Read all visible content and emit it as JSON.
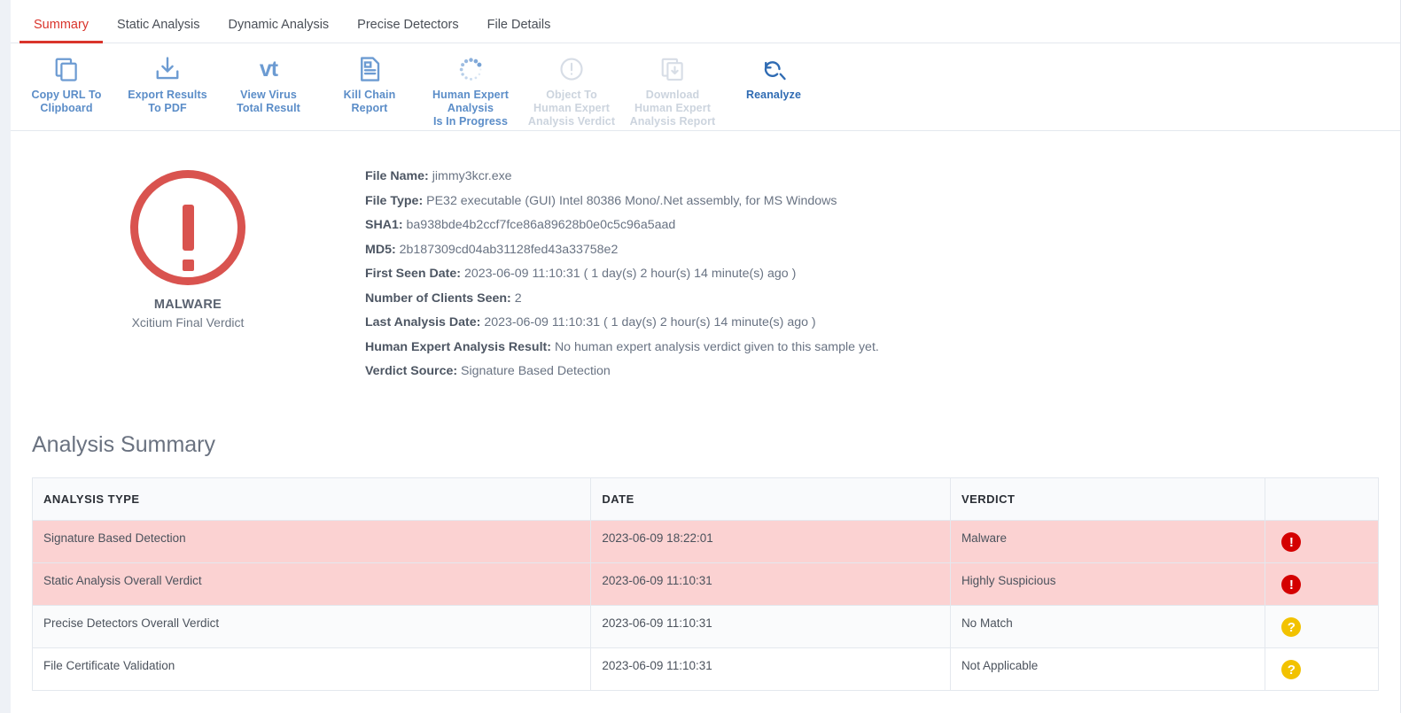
{
  "tabs": [
    {
      "label": "Summary",
      "active": true
    },
    {
      "label": "Static Analysis",
      "active": false
    },
    {
      "label": "Dynamic Analysis",
      "active": false
    },
    {
      "label": "Precise Detectors",
      "active": false
    },
    {
      "label": "File Details",
      "active": false
    }
  ],
  "toolbar": [
    {
      "icon": "copy-icon",
      "line1": "Copy URL To",
      "line2": "Clipboard",
      "line3": "",
      "state": "enabled"
    },
    {
      "icon": "download-pdf-icon",
      "line1": "Export Results",
      "line2": "To PDF",
      "line3": "",
      "state": "enabled"
    },
    {
      "icon": "virustotal-icon",
      "line1": "View Virus",
      "line2": "Total Result",
      "line3": "",
      "state": "enabled"
    },
    {
      "icon": "document-icon",
      "line1": "Kill Chain",
      "line2": "Report",
      "line3": "",
      "state": "enabled"
    },
    {
      "icon": "spinner-icon",
      "line1": "Human Expert",
      "line2": "Analysis",
      "line3": "Is In Progress",
      "state": "enabled"
    },
    {
      "icon": "alert-circle-icon",
      "line1": "Object To",
      "line2": "Human Expert",
      "line3": "Analysis Verdict",
      "state": "disabled"
    },
    {
      "icon": "download-report-icon",
      "line1": "Download",
      "line2": "Human Expert",
      "line3": "Analysis Report",
      "state": "disabled"
    },
    {
      "icon": "reanalyze-icon",
      "line1": "Reanalyze",
      "line2": "",
      "line3": "",
      "state": "dark"
    }
  ],
  "verdict": {
    "icon": "malware-alert-icon",
    "title": "MALWARE",
    "subtitle": "Xcitium Final Verdict",
    "color": "#d9534f"
  },
  "file_info": [
    {
      "label": "File Name:",
      "value": "jimmy3kcr.exe"
    },
    {
      "label": "File Type:",
      "value": "PE32 executable (GUI) Intel 80386 Mono/.Net assembly, for MS Windows"
    },
    {
      "label": "SHA1:",
      "value": "ba938bde4b2ccf7fce86a89628b0e0c5c96a5aad"
    },
    {
      "label": "MD5:",
      "value": "2b187309cd04ab31128fed43a33758e2"
    },
    {
      "label": "First Seen Date:",
      "value": "2023-06-09 11:10:31 ( 1 day(s) 2 hour(s) 14 minute(s) ago )"
    },
    {
      "label": "Number of Clients Seen:",
      "value": "2"
    },
    {
      "label": "Last Analysis Date:",
      "value": "2023-06-09 11:10:31 ( 1 day(s) 2 hour(s) 14 minute(s) ago )"
    },
    {
      "label": "Human Expert Analysis Result:",
      "value": "No human expert analysis verdict given to this sample yet."
    },
    {
      "label": "Verdict Source:",
      "value": "Signature Based Detection"
    }
  ],
  "analysis_summary": {
    "title": "Analysis Summary",
    "columns": [
      "ANALYSIS TYPE",
      "DATE",
      "VERDICT",
      ""
    ],
    "rows": [
      {
        "type": "Signature Based Detection",
        "date": "2023-06-09 18:22:01",
        "verdict": "Malware",
        "badge": "!",
        "badge_color": "red",
        "badge_icon": "malware-badge-icon",
        "row_style": "danger"
      },
      {
        "type": "Static Analysis Overall Verdict",
        "date": "2023-06-09 11:10:31",
        "verdict": "Highly Suspicious",
        "badge": "!",
        "badge_color": "red",
        "badge_icon": "suspicious-badge-icon",
        "row_style": "danger"
      },
      {
        "type": "Precise Detectors Overall Verdict",
        "date": "2023-06-09 11:10:31",
        "verdict": "No Match",
        "badge": "?",
        "badge_color": "yellow",
        "badge_icon": "unknown-badge-icon",
        "row_style": "normal"
      },
      {
        "type": "File Certificate Validation",
        "date": "2023-06-09 11:10:31",
        "verdict": "Not Applicable",
        "badge": "?",
        "badge_color": "yellow",
        "badge_icon": "unknown-badge-icon",
        "row_style": "plain"
      }
    ]
  }
}
